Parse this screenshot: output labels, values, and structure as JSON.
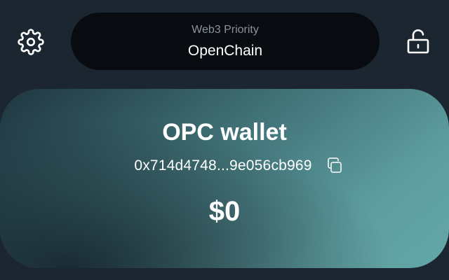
{
  "header": {
    "settings_icon": "gear-icon",
    "network": {
      "subtitle": "Web3 Priority",
      "name": "OpenChain"
    },
    "lock_icon": "unlock-icon"
  },
  "wallet": {
    "title": "OPC wallet",
    "address": "0x714d4748...9e056cb969",
    "copy_icon": "copy-icon",
    "balance": "$0"
  },
  "colors": {
    "background": "#1b2630",
    "pill": "#080c10",
    "card_gradient_start": "#1f3540",
    "card_gradient_end": "#64a7a7",
    "muted_text": "#8b939b"
  }
}
